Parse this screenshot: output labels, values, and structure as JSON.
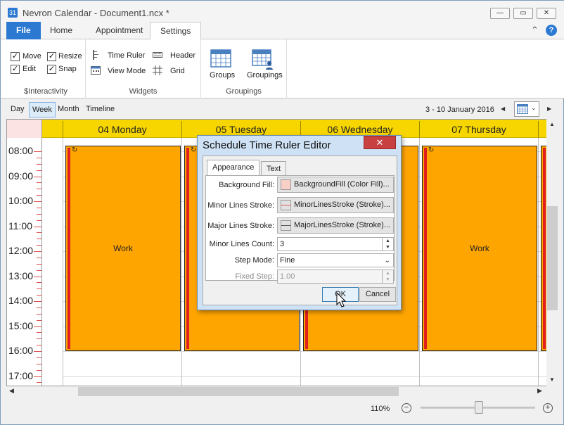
{
  "window": {
    "title": "Nevron Calendar - Document1.ncx *",
    "minimize_glyph": "▭",
    "maximize_glyph": "▭",
    "close_glyph": "✕"
  },
  "ribbon": {
    "tabs": [
      {
        "label": "File"
      },
      {
        "label": "Home"
      },
      {
        "label": "Appointment"
      },
      {
        "label": "Settings"
      }
    ],
    "active_tab": "Settings",
    "collapse_glyph": "⌃",
    "help_glyph": "?",
    "interactivity": {
      "group_label": "$Interactivity",
      "checkboxes": [
        {
          "label": "Move",
          "checked": true
        },
        {
          "label": "Resize",
          "checked": true
        },
        {
          "label": "Edit",
          "checked": true
        },
        {
          "label": "Snap",
          "checked": true
        }
      ]
    },
    "widgets": {
      "group_label": "Widgets",
      "items": [
        {
          "label": "Time Ruler",
          "icon": "time-ruler-icon"
        },
        {
          "label": "Header",
          "icon": "header-icon"
        },
        {
          "label": "View Mode",
          "icon": "view-mode-icon"
        },
        {
          "label": "Grid",
          "icon": "grid-icon"
        }
      ]
    },
    "groupings": {
      "group_label": "Groupings",
      "items": [
        {
          "label": "Groups",
          "icon": "groups-icon"
        },
        {
          "label": "Groupings",
          "icon": "groupings-icon"
        }
      ]
    }
  },
  "viewbar": {
    "modes": [
      {
        "label": "Day"
      },
      {
        "label": "Week"
      },
      {
        "label": "Month"
      },
      {
        "label": "Timeline"
      }
    ],
    "active_mode": "Week",
    "date_range": "3 - 10 January 2016",
    "prev_glyph": "◀",
    "next_glyph": "▶"
  },
  "calendar": {
    "days": [
      {
        "label": "04 Monday"
      },
      {
        "label": "05 Tuesday"
      },
      {
        "label": "06 Wednesday"
      },
      {
        "label": "07 Thursday"
      }
    ],
    "hours": [
      "08:00",
      "09:00",
      "10:00",
      "11:00",
      "12:00",
      "13:00",
      "14:00",
      "15:00",
      "16:00",
      "17:00"
    ],
    "appointments": [
      {
        "day": "04 Monday",
        "subject": "Work",
        "recurring": true
      },
      {
        "day": "05 Tuesday",
        "subject": "",
        "recurring": true
      },
      {
        "day": "06 Wednesday",
        "subject": "",
        "recurring": false
      },
      {
        "day": "07 Thursday",
        "subject": "Work",
        "recurring": true
      }
    ],
    "accent_color": "#f7d600",
    "appointment_color": "#ffa500"
  },
  "statusbar": {
    "zoom_label": "110%",
    "zoom_out_glyph": "−",
    "zoom_in_glyph": "+",
    "zoom_level": 0.5
  },
  "dialog": {
    "title": "Schedule Time Ruler Editor",
    "close_glyph": "✕",
    "tabs": [
      {
        "label": "Appearance"
      },
      {
        "label": "Text"
      }
    ],
    "active_tab": "Appearance",
    "properties": {
      "background_fill": {
        "label": "Background Fill:",
        "value": "BackgroundFill (Color Fill)..."
      },
      "minor_lines_stroke": {
        "label": "Minor Lines Stroke:",
        "value": "MinorLinesStroke (Stroke)..."
      },
      "major_lines_stroke": {
        "label": "Major Lines Stroke:",
        "value": "MajorLinesStroke (Stroke)..."
      },
      "minor_lines_count": {
        "label": "Minor Lines Count:",
        "value": "3"
      },
      "step_mode": {
        "label": "Step Mode:",
        "value": "Fine"
      },
      "fixed_step": {
        "label": "Fixed Step:",
        "value": "1.00"
      }
    },
    "ok_label": "OK",
    "cancel_label": "Cancel"
  }
}
